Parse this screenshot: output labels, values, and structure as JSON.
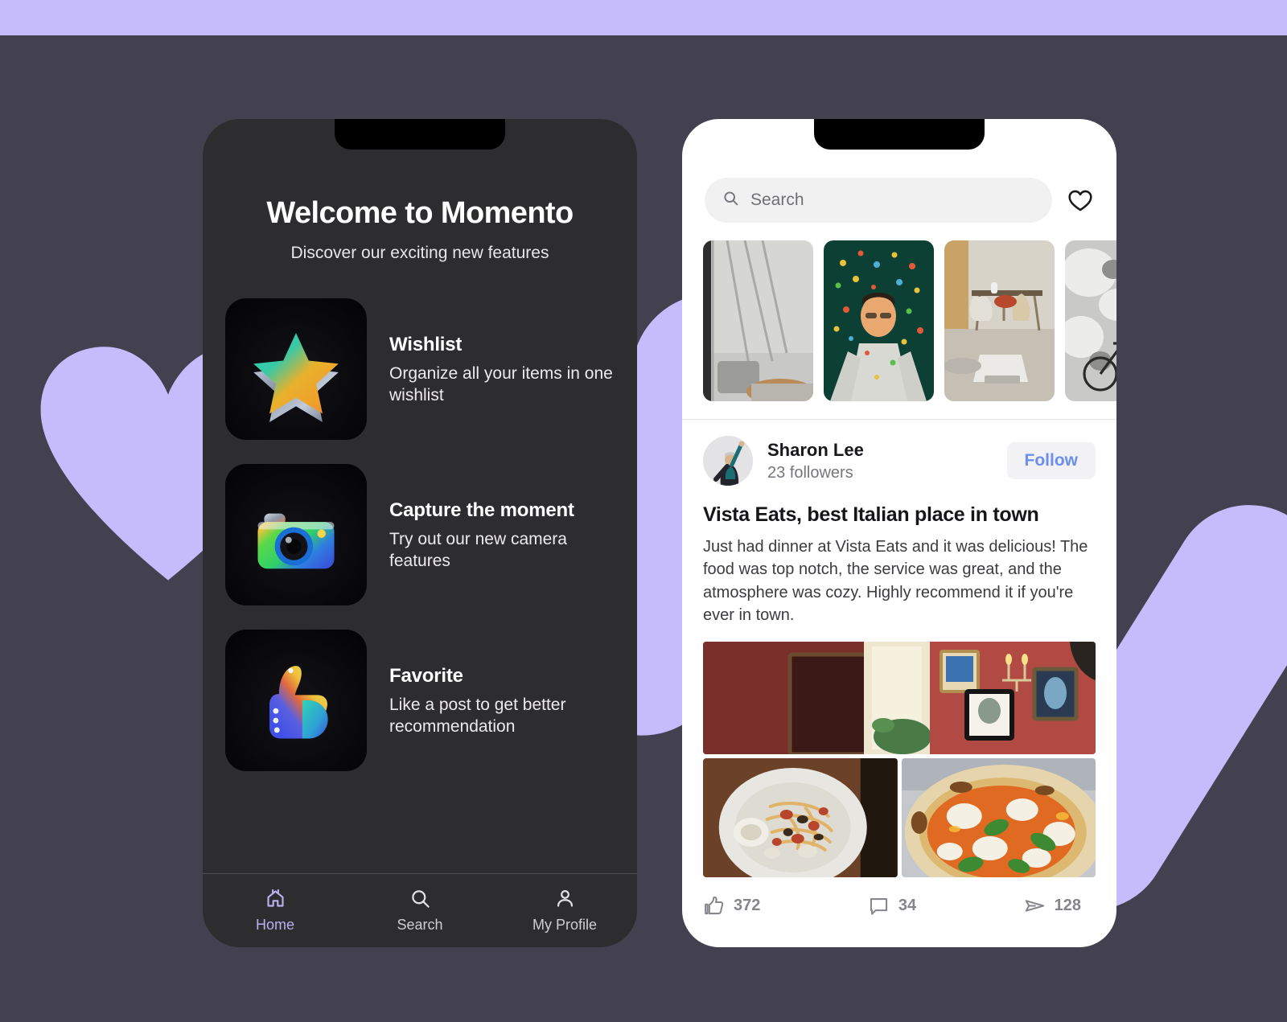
{
  "theme": {
    "page_bg": "#43414f",
    "accent_purple": "#c6bcfb",
    "tab_active": "#b9b0f0",
    "follow_blue": "#6b8ef0"
  },
  "left_phone": {
    "title": "Welcome to Momento",
    "subtitle": "Discover our exciting new features",
    "features": [
      {
        "icon": "star-3d-icon",
        "title": "Wishlist",
        "description": "Organize all your items in one wishlist"
      },
      {
        "icon": "camera-3d-icon",
        "title": "Capture the moment",
        "description": "Try out our new camera features"
      },
      {
        "icon": "thumbs-up-3d-icon",
        "title": "Favorite",
        "description": "Like a post to get better recommendation"
      }
    ],
    "tabbar": [
      {
        "icon": "home-icon",
        "label": "Home",
        "active": true
      },
      {
        "icon": "search-icon",
        "label": "Search",
        "active": false
      },
      {
        "icon": "person-icon",
        "label": "My Profile",
        "active": false
      }
    ]
  },
  "right_phone": {
    "search": {
      "icon": "search-icon",
      "placeholder": "Search",
      "value": ""
    },
    "heart_icon": "heart-outline-icon",
    "carousel": [
      {
        "name": "window-interior-photo"
      },
      {
        "name": "confetti-portrait-photo"
      },
      {
        "name": "workspace-photo"
      },
      {
        "name": "bicycle-wall-photo"
      }
    ],
    "author": {
      "avatar": "user-avatar",
      "name": "Sharon Lee",
      "followers": "23 followers",
      "follow_label": "Follow"
    },
    "post": {
      "title": "Vista Eats, best Italian place in town",
      "body": "Just had dinner at Vista Eats and it was delicious! The food was top notch, the service was great, and the atmosphere was cozy. Highly recommend it if you're ever in town.",
      "photos": [
        {
          "name": "restaurant-interior-photo"
        },
        {
          "name": "pasta-dish-photo"
        },
        {
          "name": "pizza-photo"
        }
      ]
    },
    "actions": [
      {
        "icon": "thumbs-up-icon",
        "count": "372"
      },
      {
        "icon": "comment-icon",
        "count": "34"
      },
      {
        "icon": "share-icon",
        "count": "128"
      }
    ]
  }
}
